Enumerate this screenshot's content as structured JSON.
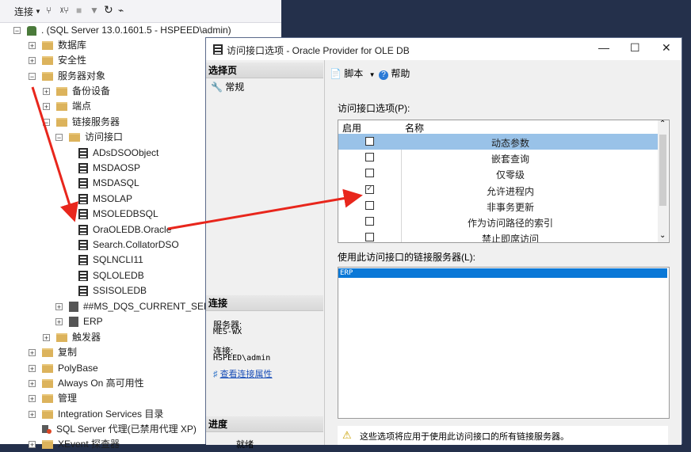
{
  "explorer": {
    "toolbar": {
      "connect_label": "连接",
      "icons": [
        "filter-connect-icon",
        "disconnect-icon",
        "stop-icon",
        "filter-icon",
        "refresh-icon",
        "activity-icon"
      ]
    },
    "root": ". (SQL Server 13.0.1601.5 - HSPEED\\admin)",
    "nodes": [
      {
        "label": "数据库",
        "expander": "⊞"
      },
      {
        "label": "安全性",
        "expander": "⊞"
      },
      {
        "label": "服务器对象",
        "expander": "⊟"
      },
      {
        "label": "备份设备",
        "expander": "⊞"
      },
      {
        "label": "端点",
        "expander": "⊞"
      },
      {
        "label": "链接服务器",
        "expander": "⊟"
      },
      {
        "label": "访问接口",
        "expander": "⊟"
      },
      {
        "label": "ADsDSOObject"
      },
      {
        "label": "MSDAOSP"
      },
      {
        "label": "MSDASQL"
      },
      {
        "label": "MSOLAP"
      },
      {
        "label": "MSOLEDBSQL"
      },
      {
        "label": "OraOLEDB.Oracle"
      },
      {
        "label": "Search.CollatorDSO"
      },
      {
        "label": "SQLNCLI11"
      },
      {
        "label": "SQLOLEDB"
      },
      {
        "label": "SSISOLEDB"
      },
      {
        "label": "##MS_DQS_CURRENT_SERVER##",
        "expander": "⊞"
      },
      {
        "label": "ERP",
        "expander": "⊞"
      },
      {
        "label": "触发器",
        "expander": "⊞"
      },
      {
        "label": "复制",
        "expander": "⊞"
      },
      {
        "label": "PolyBase",
        "expander": "⊞"
      },
      {
        "label": "Always On 高可用性",
        "expander": "⊞"
      },
      {
        "label": "管理",
        "expander": "⊞"
      },
      {
        "label": "Integration Services 目录",
        "expander": "⊞"
      },
      {
        "label": "SQL Server 代理(已禁用代理 XP)"
      },
      {
        "label": "XEvent 探查器",
        "expander": "⊞"
      }
    ]
  },
  "dialog": {
    "title": "访问接口选项 - Oracle Provider for OLE DB",
    "controls": {
      "minimize": "—",
      "maximize": "☐",
      "close": "✕"
    },
    "left": {
      "select_page_header": "选择页",
      "pages": [
        "常规"
      ],
      "connection_header": "连接",
      "server_label": "服务器:",
      "server_value": "MES-WX",
      "connection_label": "连接:",
      "connection_value": "HSPEED\\admin",
      "view_props_link": "查看连接属性",
      "progress_header": "进度",
      "progress_status": "就绪"
    },
    "toolbar": {
      "script_label": "脚本",
      "help_label": "帮助"
    },
    "options_label": "访问接口选项(P):",
    "grid_headers": {
      "enabled": "启用",
      "name": "名称"
    },
    "options": [
      {
        "name": "动态参数",
        "checked": false,
        "selected": true
      },
      {
        "name": "嵌套查询",
        "checked": false
      },
      {
        "name": "仅零级",
        "checked": false
      },
      {
        "name": "允许进程内",
        "checked": true
      },
      {
        "name": "非事务更新",
        "checked": false
      },
      {
        "name": "作为访问路径的索引",
        "checked": false
      },
      {
        "name": "禁止即席访问",
        "checked": false
      }
    ],
    "linked_servers_label": "使用此访问接口的链接服务器(L):",
    "linked_servers": [
      "ERP"
    ],
    "warning": "这些选项将应用于使用此访问接口的所有链接服务器。"
  }
}
